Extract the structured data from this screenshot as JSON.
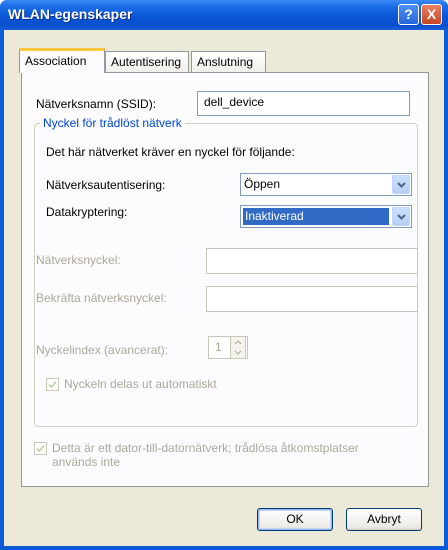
{
  "window": {
    "title": "WLAN-egenskaper",
    "help_label": "?",
    "close_label": "X"
  },
  "tabs": [
    "Association",
    "Autentisering",
    "Anslutning"
  ],
  "association": {
    "ssid_label": "Nätverksnamn (SSID):",
    "ssid_value": "dell_device",
    "group_title": "Nyckel för trådlöst nätverk",
    "requirement_text": "Det här nätverket kräver en nyckel för följande:",
    "auth_label": "Nätverksautentisering:",
    "auth_value": "Öppen",
    "encryption_label": "Datakryptering:",
    "encryption_value": "Inaktiverad",
    "network_key_label": "Nätverksnyckel:",
    "network_key_value": "",
    "confirm_key_label": "Bekräfta nätverksnyckel:",
    "confirm_key_value": "",
    "key_index_label": "Nyckelindex (avancerat):",
    "key_index_value": "1",
    "auto_key_label": "Nyckeln delas ut automatiskt",
    "auto_key_checked": true,
    "adhoc_label_line1": "Detta är ett dator-till-datornätverk; trådlösa åtkomstplatser",
    "adhoc_label_line2": "används inte",
    "adhoc_checked": true
  },
  "buttons": {
    "ok": "OK",
    "cancel": "Avbryt"
  }
}
